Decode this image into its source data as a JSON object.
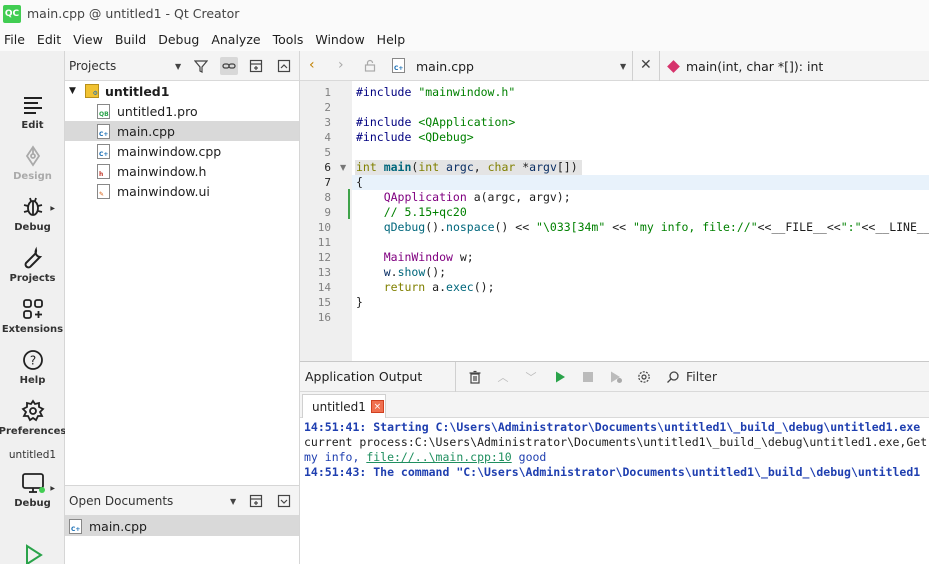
{
  "window": {
    "logo": "QC",
    "title": "main.cpp @ untitled1 - Qt Creator"
  },
  "menu": [
    "File",
    "Edit",
    "View",
    "Build",
    "Debug",
    "Analyze",
    "Tools",
    "Window",
    "Help"
  ],
  "modes": [
    {
      "label": "Edit",
      "icon": "edit-icon"
    },
    {
      "label": "Design",
      "icon": "design-icon"
    },
    {
      "label": "Debug",
      "icon": "debug-icon"
    },
    {
      "label": "Projects",
      "icon": "wrench-icon"
    },
    {
      "label": "Extensions",
      "icon": "extensions-icon"
    },
    {
      "label": "Help",
      "icon": "help-icon"
    },
    {
      "label": "Preferences",
      "icon": "gear-icon"
    }
  ],
  "kit": {
    "name": "untitled1",
    "mode_label": "Debug"
  },
  "projects": {
    "title": "Projects",
    "root": "untitled1",
    "files": [
      "untitled1.pro",
      "main.cpp",
      "mainwindow.cpp",
      "mainwindow.h",
      "mainwindow.ui"
    ]
  },
  "open_documents": {
    "title": "Open Documents",
    "files": [
      "main.cpp"
    ]
  },
  "editor": {
    "file": "main.cpp",
    "symbol": "main(int, char *[]): int",
    "line_numbers": [
      "1",
      "2",
      "3",
      "4",
      "5",
      "6",
      "7",
      "8",
      "9",
      "10",
      "11",
      "12",
      "13",
      "14",
      "15",
      "16"
    ],
    "code": {
      "l1_pp": "#include",
      "l1_str": " \"mainwindow.h\"",
      "l3_pp": "#include",
      "l3_str": " <QApplication>",
      "l4_pp": "#include",
      "l4_str": " <QDebug>",
      "l6_kw1": "int",
      "l6_fn": " main",
      "l6_p1": "(",
      "l6_kw2": "int",
      "l6_v1": " argc",
      "l6_p2": ", ",
      "l6_kw3": "char",
      "l6_p3": " *",
      "l6_v2": "argv",
      "l6_p4": "[])",
      "l7": "{",
      "l8_ty": "    QApplication",
      "l8_rest": " a(argc, argv);",
      "l9": "    // 5.15+qc20",
      "l10_fn": "    qDebug",
      "l10_p1": "().",
      "l10_fn2": "nospace",
      "l10_p2": "() << ",
      "l10_str1": "\"\\033[34m\"",
      "l10_p3": " << ",
      "l10_str2": "\"my info, file://\"",
      "l10_p4": "<<__FILE__<<",
      "l10_str3": "\":\"",
      "l10_p5": "<<__LINE__",
      "l12_ty": "    MainWindow",
      "l12_rest": " w;",
      "l13_v": "    w",
      "l13_p": ".",
      "l13_fn": "show",
      "l13_rest": "();",
      "l14_kw": "    return",
      "l14_rest": " a.",
      "l14_fn": "exec",
      "l14_end": "();",
      "l15": "}"
    }
  },
  "output": {
    "title": "Application Output",
    "filter_placeholder": "Filter",
    "tab": "untitled1",
    "tab_close": "×",
    "lines": {
      "l1": "14:51:41: Starting C:\\Users\\Administrator\\Documents\\untitled1\\_build_\\debug\\untitled1.exe",
      "l2": "current process:C:\\Users\\Administrator\\Documents\\untitled1\\_build_\\debug\\untitled1.exe,Get",
      "l3_prefix": "my info, ",
      "l3_link": "file://..\\main.cpp:10",
      "l3_suffix": " good",
      "l4": "14:51:43: The command \"C:\\Users\\Administrator\\Documents\\untitled1\\_build_\\debug\\untitled1"
    }
  }
}
